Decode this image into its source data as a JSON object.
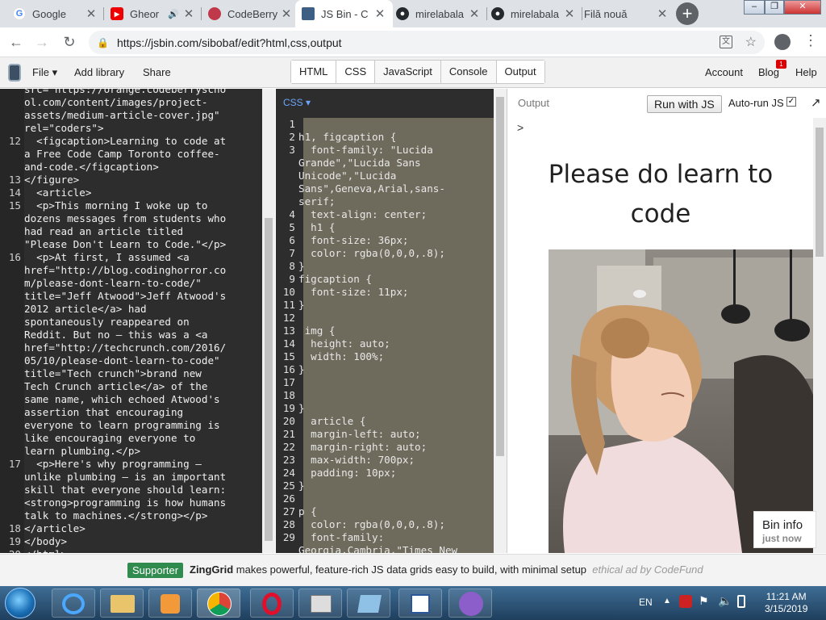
{
  "browser": {
    "tabs": [
      {
        "title": "Google",
        "favicon": "google-icon",
        "active": false
      },
      {
        "title": "Gheor",
        "favicon": "youtube-icon",
        "active": false
      },
      {
        "title": "CodeBerry",
        "favicon": "codeberry-icon",
        "active": false
      },
      {
        "title": "JS Bin - C",
        "favicon": "jsbin-icon",
        "active": true
      },
      {
        "title": "mirelabala",
        "favicon": "github-icon",
        "active": false
      },
      {
        "title": "mirelabala",
        "favicon": "github-icon",
        "active": false
      },
      {
        "title": "Filă nouă",
        "favicon": "",
        "active": false
      }
    ],
    "url": "https://jsbin.com/sibobaf/edit?html,css,output"
  },
  "jsbin": {
    "file": "File",
    "add_library": "Add library",
    "share": "Share",
    "panels": [
      "HTML",
      "CSS",
      "JavaScript",
      "Console",
      "Output"
    ],
    "account": "Account",
    "blog": "Blog",
    "blog_badge": "1",
    "help": "Help"
  },
  "html_editor": {
    "lines": [
      {
        "n": "",
        "t": "src=\"https://orange.codeberryscho"
      },
      {
        "n": "",
        "t": "ol.com/content/images/project-"
      },
      {
        "n": "",
        "t": "assets/medium-article-cover.jpg\""
      },
      {
        "n": "",
        "t": "rel=\"coders\">"
      },
      {
        "n": "12",
        "t": "  <figcaption>Learning to code at"
      },
      {
        "n": "",
        "t": "a Free Code Camp Toronto coffee-"
      },
      {
        "n": "",
        "t": "and-code.</figcaption>"
      },
      {
        "n": "13",
        "t": "</figure>"
      },
      {
        "n": "14",
        "t": "  <article>"
      },
      {
        "n": "15",
        "t": "  <p>This morning I woke up to"
      },
      {
        "n": "",
        "t": "dozens messages from students who"
      },
      {
        "n": "",
        "t": "had read an article titled"
      },
      {
        "n": "",
        "t": "\"Please Don't Learn to Code.\"</p>"
      },
      {
        "n": "16",
        "t": "  <p>At first, I assumed <a"
      },
      {
        "n": "",
        "t": "href=\"http://blog.codinghorror.co"
      },
      {
        "n": "",
        "t": "m/please-dont-learn-to-code/\""
      },
      {
        "n": "",
        "t": "title=\"Jeff Atwood\">Jeff Atwood's"
      },
      {
        "n": "",
        "t": "2012 article</a> had"
      },
      {
        "n": "",
        "t": "spontaneously reappeared on"
      },
      {
        "n": "",
        "t": "Reddit. But no – this was a <a"
      },
      {
        "n": "",
        "t": "href=\"http://techcrunch.com/2016/"
      },
      {
        "n": "",
        "t": "05/10/please-dont-learn-to-code\""
      },
      {
        "n": "",
        "t": "title=\"Tech crunch\">brand new"
      },
      {
        "n": "",
        "t": "Tech Crunch article</a> of the"
      },
      {
        "n": "",
        "t": "same name, which echoed Atwood's"
      },
      {
        "n": "",
        "t": "assertion that encouraging"
      },
      {
        "n": "",
        "t": "everyone to learn programming is"
      },
      {
        "n": "",
        "t": "like encouraging everyone to"
      },
      {
        "n": "",
        "t": "learn plumbing.</p>"
      },
      {
        "n": "17",
        "t": "  <p>Here's why programming –"
      },
      {
        "n": "",
        "t": "unlike plumbing – is an important"
      },
      {
        "n": "",
        "t": "skill that everyone should learn:"
      },
      {
        "n": "",
        "t": "<strong>programming is how humans"
      },
      {
        "n": "",
        "t": "talk to machines.</strong></p>"
      },
      {
        "n": "18",
        "t": "</article>"
      },
      {
        "n": "19",
        "t": "</body>"
      },
      {
        "n": "20",
        "t": "</html>"
      }
    ]
  },
  "css_editor": {
    "label": "CSS",
    "lines": [
      {
        "n": "1",
        "t": ""
      },
      {
        "n": "2",
        "t": "h1, figcaption {"
      },
      {
        "n": "3",
        "t": "  font-family: \"Lucida"
      },
      {
        "n": "",
        "t": "Grande\",\"Lucida Sans"
      },
      {
        "n": "",
        "t": "Unicode\",\"Lucida"
      },
      {
        "n": "",
        "t": "Sans\",Geneva,Arial,sans-"
      },
      {
        "n": "",
        "t": "serif;"
      },
      {
        "n": "4",
        "t": "  text-align: center;"
      },
      {
        "n": "5",
        "t": "  h1 {"
      },
      {
        "n": "6",
        "t": "  font-size: 36px;"
      },
      {
        "n": "7",
        "t": "  color: rgba(0,0,0,.8);"
      },
      {
        "n": "8",
        "t": "}"
      },
      {
        "n": "9",
        "t": "figcaption {"
      },
      {
        "n": "10",
        "t": "  font-size: 11px;"
      },
      {
        "n": "11",
        "t": "}"
      },
      {
        "n": "12",
        "t": ""
      },
      {
        "n": "13",
        "t": " img {"
      },
      {
        "n": "14",
        "t": "  height: auto;"
      },
      {
        "n": "15",
        "t": "  width: 100%;"
      },
      {
        "n": "16",
        "t": "}"
      },
      {
        "n": "17",
        "t": ""
      },
      {
        "n": "18",
        "t": ""
      },
      {
        "n": "19",
        "t": "}"
      },
      {
        "n": "20",
        "t": "  article {"
      },
      {
        "n": "21",
        "t": "  margin-left: auto;"
      },
      {
        "n": "22",
        "t": "  margin-right: auto;"
      },
      {
        "n": "23",
        "t": "  max-width: 700px;"
      },
      {
        "n": "24",
        "t": "  padding: 10px;"
      },
      {
        "n": "25",
        "t": "}"
      },
      {
        "n": "26",
        "t": ""
      },
      {
        "n": "27",
        "t": "p {"
      },
      {
        "n": "28",
        "t": "  color: rgba(0,0,0,.8);"
      },
      {
        "n": "29",
        "t": "  font-family:"
      },
      {
        "n": "",
        "t": "Georgia,Cambria,\"Times New"
      }
    ]
  },
  "output": {
    "label": "Output",
    "run_button": "Run with JS",
    "autorun": "Auto-run JS",
    "caret": ">",
    "heading": "Please do learn to code",
    "bin_info": "Bin info",
    "bin_info_sub": "just now"
  },
  "ad": {
    "badge": "Supporter",
    "brand": "ZingGrid",
    "text": " makes powerful, feature-rich JS data grids easy to build, with minimal setup",
    "suffix": "ethical ad by CodeFund"
  },
  "taskbar": {
    "lang": "EN",
    "time": "11:21 AM",
    "date": "3/15/2019"
  },
  "colors": {
    "jsbin_bg": "#2d2d2d",
    "css_highlight": "#6e6a5c",
    "supporter_badge": "#2f8c4e",
    "chrome_tabbar": "#dee1e6"
  }
}
